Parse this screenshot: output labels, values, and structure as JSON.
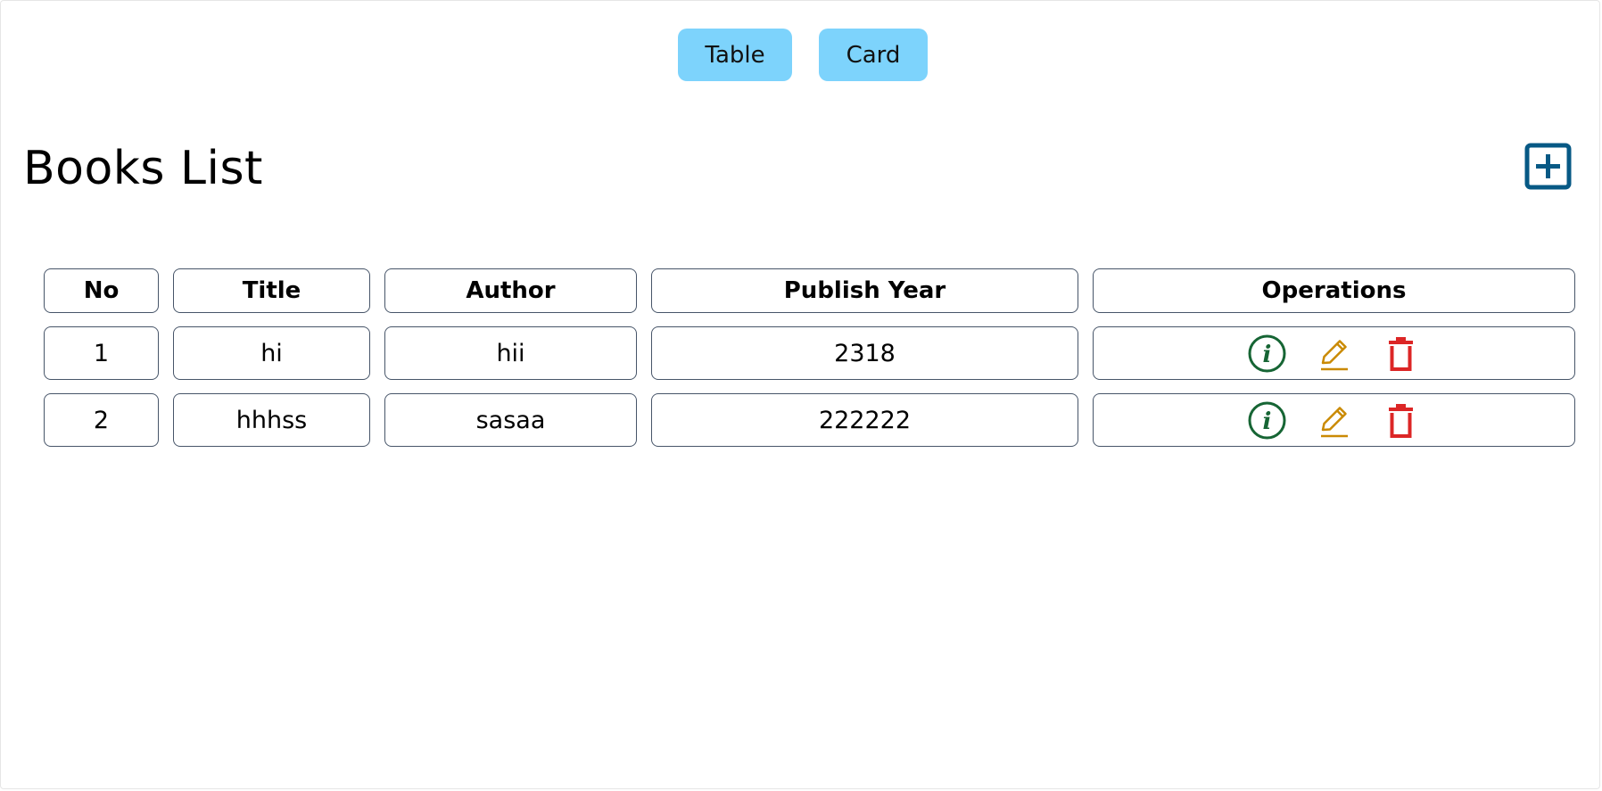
{
  "view_toggle": {
    "table_label": "Table",
    "card_label": "Card"
  },
  "page": {
    "title": "Books List",
    "add_icon": "plus-square-icon"
  },
  "table": {
    "headers": [
      "No",
      "Title",
      "Author",
      "Publish Year",
      "Operations"
    ],
    "rows": [
      {
        "no": "1",
        "title": "hi",
        "author": "hii",
        "publish_year": "2318"
      },
      {
        "no": "2",
        "title": "hhhss",
        "author": "sasaa",
        "publish_year": "222222"
      }
    ],
    "operation_icons": [
      "info-circle-icon",
      "edit-pencil-icon",
      "trash-icon"
    ]
  },
  "colors": {
    "toggle_bg": "#7dd3fc",
    "add_icon": "#075985",
    "info_icon": "#166534",
    "edit_icon": "#ca8a04",
    "delete_icon": "#dc2626",
    "cell_border": "#475569"
  }
}
